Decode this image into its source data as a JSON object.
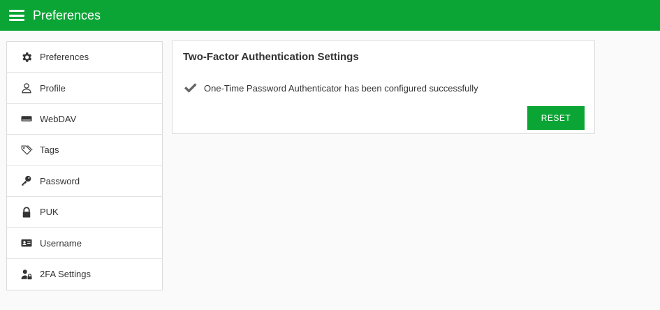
{
  "header": {
    "title": "Preferences",
    "menu_icon": "hamburger-menu-icon",
    "background_color": "#0aa535"
  },
  "sidebar": {
    "items": [
      {
        "label": "Preferences",
        "icon": "gear-icon"
      },
      {
        "label": "Profile",
        "icon": "user-icon"
      },
      {
        "label": "WebDAV",
        "icon": "drive-icon"
      },
      {
        "label": "Tags",
        "icon": "tags-icon"
      },
      {
        "label": "Password",
        "icon": "key-icon"
      },
      {
        "label": "PUK",
        "icon": "lock-icon"
      },
      {
        "label": "Username",
        "icon": "id-card-icon"
      },
      {
        "label": "2FA Settings",
        "icon": "user-lock-icon"
      }
    ]
  },
  "main": {
    "title": "Two-Factor Authentication Settings",
    "status_icon": "check-icon",
    "status_message": "One-Time Password Authenticator has been configured successfully",
    "reset_label": "RESET",
    "accent_color": "#0aa535"
  }
}
